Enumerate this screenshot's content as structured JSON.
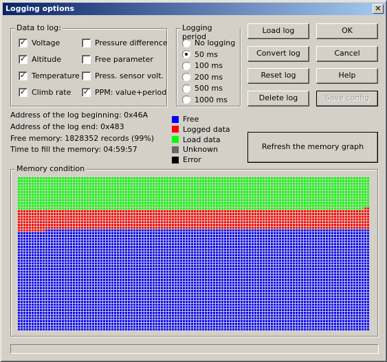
{
  "window": {
    "title": "Logging options",
    "close_label": "✕"
  },
  "data_to_log": {
    "label": "Data to log:",
    "items": [
      {
        "label": "Voltage",
        "checked": true
      },
      {
        "label": "Altitude",
        "checked": true
      },
      {
        "label": "Temperature",
        "checked": true
      },
      {
        "label": "Climb rate",
        "checked": true
      },
      {
        "label": "Pressure difference",
        "checked": false
      },
      {
        "label": "Free parameter",
        "checked": false
      },
      {
        "label": "Press. sensor volt.",
        "checked": false
      },
      {
        "label": "PPM: value+period",
        "checked": true
      }
    ]
  },
  "logging_period": {
    "label": "Logging period",
    "options": [
      {
        "label": "No logging",
        "selected": false
      },
      {
        "label": "50 ms",
        "selected": true
      },
      {
        "label": "100 ms",
        "selected": false
      },
      {
        "label": "200 ms",
        "selected": false
      },
      {
        "label": "500 ms",
        "selected": false
      },
      {
        "label": "1000 ms",
        "selected": false
      }
    ]
  },
  "buttons": {
    "load_log": "Load log",
    "convert_log": "Convert log",
    "reset_log": "Reset log",
    "delete_log": "Delete log",
    "ok": "OK",
    "cancel": "Cancel",
    "help": "Help",
    "save_config": "Save config",
    "refresh": "Refresh the memory graph"
  },
  "info": {
    "log_begin": "Address of the log beginning: 0x46A",
    "log_end": "Address of the log end: 0x483",
    "free_memory": "Free memory: 1828352 records (99%)",
    "time_to_fill": "Time to fill the memory: 04:59:57"
  },
  "legend": [
    {
      "label": "Free",
      "color": "#0000ff"
    },
    {
      "label": "Logged data",
      "color": "#ff0000"
    },
    {
      "label": "Load data",
      "color": "#00ff00"
    },
    {
      "label": "Unknown",
      "color": "#666666"
    },
    {
      "label": "Error",
      "color": "#000000"
    }
  ],
  "memory": {
    "label": "Memory condition",
    "columns": 128,
    "rows": 56,
    "load_rows": 12,
    "logged_rows": 8,
    "logged_top_partial_cols": 2,
    "logged_bottom_partial_cols": 10
  },
  "progress": {
    "value": 0
  }
}
